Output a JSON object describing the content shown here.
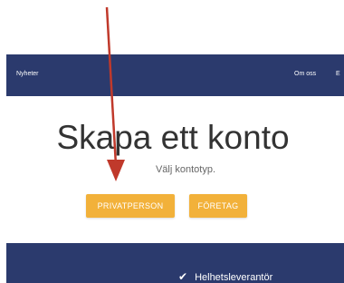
{
  "nav": {
    "news_label": "Nyheter",
    "about_label": "Om oss",
    "cut_label": "E"
  },
  "main": {
    "title": "Skapa ett konto",
    "subtitle": "Välj kontotyp.",
    "buttons": {
      "private_label": "PRIVATPERSON",
      "company_label": "FÖRETAG"
    }
  },
  "footer": {
    "feature_label": "Helhetsleverantör",
    "feature_icon": "check-icon"
  },
  "annotation": {
    "arrow_color": "#c0392b"
  },
  "colors": {
    "navbar": "#2b3a6d",
    "button": "#f2b13a",
    "title": "#333333"
  }
}
